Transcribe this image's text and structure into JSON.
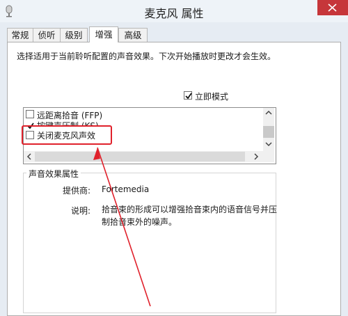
{
  "window": {
    "title": "麦克风 属性"
  },
  "tabs": [
    "常规",
    "侦听",
    "级别",
    "增强",
    "高级"
  ],
  "active_tab": "增强",
  "description": "选择适用于当前聆听配置的声音效果。下次开始播放时更改才会生效。",
  "immediate_mode": {
    "label": "立即模式",
    "checked": true
  },
  "effects": [
    {
      "label": "远距离拾音 (FFP)",
      "checked": false
    },
    {
      "label": "按键声压制 (KS)",
      "checked": true
    },
    {
      "label": "关闭麦克风声效",
      "checked": false
    }
  ],
  "properties": {
    "group_title": "声音效果属性",
    "provider_label": "提供商:",
    "provider_value": "Fortemedia",
    "description_label": "说明:",
    "description_line1": "拾音束的形成可以增强拾音束内的语音信号并压",
    "description_line2": "制拾音束外的噪声。"
  },
  "colors": {
    "highlight": "#e0212b",
    "close_button": "#c6363a"
  },
  "icons": [
    "microphone-icon",
    "close-icon",
    "check-icon",
    "scroll-up-icon",
    "scroll-down-icon",
    "scroll-left-icon",
    "scroll-right-icon"
  ]
}
